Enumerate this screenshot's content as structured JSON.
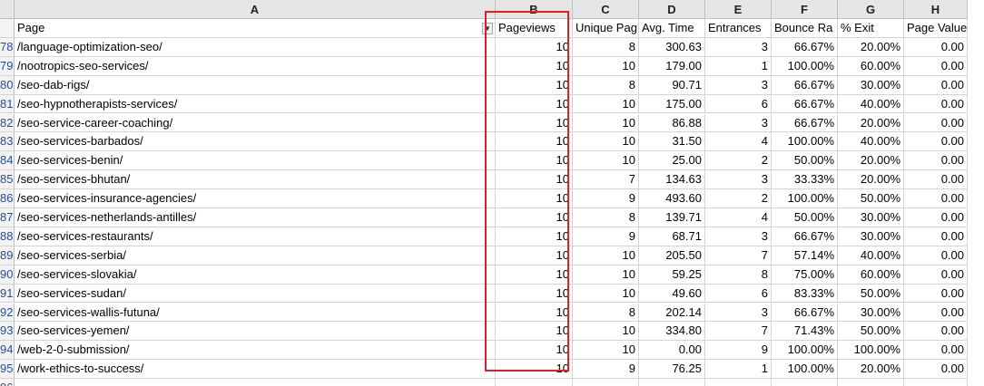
{
  "columns": [
    "A",
    "B",
    "C",
    "D",
    "E",
    "F",
    "G",
    "H"
  ],
  "header": [
    "Page",
    "Pageviews",
    "Unique Pag",
    "Avg. Time",
    "Entrances",
    "Bounce Ra",
    "% Exit",
    "Page Value"
  ],
  "filter_icon": "filter-funnel-icon",
  "rows": [
    {
      "n": "78",
      "cells": [
        "/language-optimization-seo/",
        "10",
        "8",
        "300.63",
        "3",
        "66.67%",
        "20.00%",
        "0.00"
      ]
    },
    {
      "n": "79",
      "cells": [
        "/nootropics-seo-services/",
        "10",
        "10",
        "179.00",
        "1",
        "100.00%",
        "60.00%",
        "0.00"
      ]
    },
    {
      "n": "80",
      "cells": [
        "/seo-dab-rigs/",
        "10",
        "8",
        "90.71",
        "3",
        "66.67%",
        "30.00%",
        "0.00"
      ]
    },
    {
      "n": "81",
      "cells": [
        "/seo-hypnotherapists-services/",
        "10",
        "10",
        "175.00",
        "6",
        "66.67%",
        "40.00%",
        "0.00"
      ]
    },
    {
      "n": "82",
      "cells": [
        "/seo-service-career-coaching/",
        "10",
        "10",
        "86.88",
        "3",
        "66.67%",
        "20.00%",
        "0.00"
      ]
    },
    {
      "n": "83",
      "cells": [
        "/seo-services-barbados/",
        "10",
        "10",
        "31.50",
        "4",
        "100.00%",
        "40.00%",
        "0.00"
      ]
    },
    {
      "n": "84",
      "cells": [
        "/seo-services-benin/",
        "10",
        "10",
        "25.00",
        "2",
        "50.00%",
        "20.00%",
        "0.00"
      ]
    },
    {
      "n": "85",
      "cells": [
        "/seo-services-bhutan/",
        "10",
        "7",
        "134.63",
        "3",
        "33.33%",
        "20.00%",
        "0.00"
      ]
    },
    {
      "n": "86",
      "cells": [
        "/seo-services-insurance-agencies/",
        "10",
        "9",
        "493.60",
        "2",
        "100.00%",
        "50.00%",
        "0.00"
      ]
    },
    {
      "n": "87",
      "cells": [
        "/seo-services-netherlands-antilles/",
        "10",
        "8",
        "139.71",
        "4",
        "50.00%",
        "30.00%",
        "0.00"
      ]
    },
    {
      "n": "88",
      "cells": [
        "/seo-services-restaurants/",
        "10",
        "9",
        "68.71",
        "3",
        "66.67%",
        "30.00%",
        "0.00"
      ]
    },
    {
      "n": "89",
      "cells": [
        "/seo-services-serbia/",
        "10",
        "10",
        "205.50",
        "7",
        "57.14%",
        "40.00%",
        "0.00"
      ]
    },
    {
      "n": "90",
      "cells": [
        "/seo-services-slovakia/",
        "10",
        "10",
        "59.25",
        "8",
        "75.00%",
        "60.00%",
        "0.00"
      ]
    },
    {
      "n": "91",
      "cells": [
        "/seo-services-sudan/",
        "10",
        "10",
        "49.60",
        "6",
        "83.33%",
        "50.00%",
        "0.00"
      ]
    },
    {
      "n": "92",
      "cells": [
        "/seo-services-wallis-futuna/",
        "10",
        "8",
        "202.14",
        "3",
        "66.67%",
        "30.00%",
        "0.00"
      ]
    },
    {
      "n": "93",
      "cells": [
        "/seo-services-yemen/",
        "10",
        "10",
        "334.80",
        "7",
        "71.43%",
        "50.00%",
        "0.00"
      ]
    },
    {
      "n": "94",
      "cells": [
        "/web-2-0-submission/",
        "10",
        "10",
        "0.00",
        "9",
        "100.00%",
        "100.00%",
        "0.00"
      ]
    },
    {
      "n": "95",
      "cells": [
        "/work-ethics-to-success/",
        "10",
        "9",
        "76.25",
        "1",
        "100.00%",
        "20.00%",
        "0.00"
      ]
    },
    {
      "n": "96",
      "cells": [
        "",
        "",
        "",
        "",
        "",
        "",
        "",
        ""
      ]
    }
  ]
}
